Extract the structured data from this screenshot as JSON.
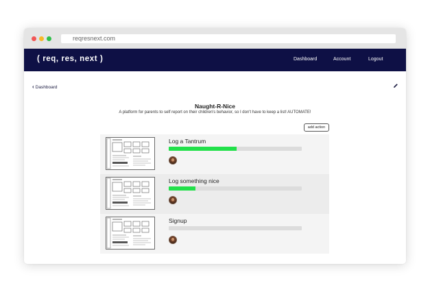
{
  "browser": {
    "url": "reqresnext.com"
  },
  "navbar": {
    "brand": "( req, res, next )",
    "links": [
      "Dashboard",
      "Account",
      "Logout"
    ]
  },
  "page": {
    "back_label": "Dashboard",
    "title": "Naught-R-Nice",
    "description": "A platform for parents to self report on their children's behavior, so I don't have to keep a list! AUTOMATE!",
    "add_action_label": "add action"
  },
  "actions": [
    {
      "label": "Log a Tantrum",
      "progress": 0.51
    },
    {
      "label": "Log something nice",
      "progress": 0.2
    },
    {
      "label": "Signup",
      "progress": 0.0
    }
  ],
  "colors": {
    "navbar_bg": "#0e1045",
    "progress_fill": "#22e04a",
    "progress_track": "#dcdcdc"
  },
  "icons": {
    "back": "chevron-left-icon",
    "edit": "pencil-icon",
    "avatar": "user-avatar"
  }
}
